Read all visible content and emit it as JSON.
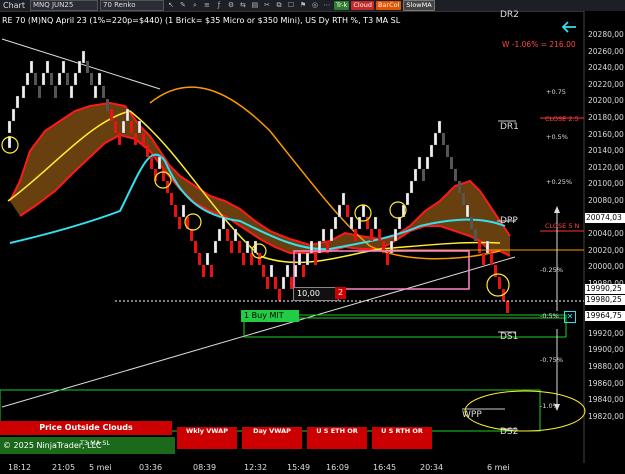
{
  "toolbar": {
    "chart_label": "Chart",
    "instrument": "MNQ JUN25",
    "bar_type": "70 Renko",
    "pills": [
      {
        "label": "Tr-k",
        "color": "#2e7d32"
      },
      {
        "label": "Cloud",
        "color": "#c62828"
      },
      {
        "label": "BarCol",
        "color": "#e65100"
      },
      {
        "label": "SlowMA",
        "color": "#444444"
      }
    ]
  },
  "info_line": "RE 70 (M)NQ April 23 (1%=220p=$440) (1 Brick= $35 Micro or $350 Mini), US Dy RTH %, T3 MA SL",
  "labels": {
    "dr2": "DR2",
    "dr1": "DR1",
    "dpp": "DPP",
    "ds1": "DS1",
    "ds2": "DS2",
    "wpp": "WPP",
    "w_pct": "W -1.06% = 216.00",
    "close_25": "CLOSE 2.5",
    "close_5": "CLOSE 5 N",
    "pct_075": "+0.75",
    "pct_05": "+0.5%",
    "pct_025": "+0.25%",
    "pct_m025": "-0.25%",
    "pct_m05": "-0.5%",
    "pct_m075": "-0.75%",
    "pct_m1": "-1.0%"
  },
  "order": {
    "qty_price": "10,00",
    "qty": "2",
    "buy_label": "1  Buy MIT"
  },
  "price_axis": {
    "ticks": [
      "20280,00",
      "20260,00",
      "20240,00",
      "20220,00",
      "20200,00",
      "20180,00",
      "20160,00",
      "20140,00",
      "20120,00",
      "20100,00",
      "20080,00",
      "20060,00",
      "20040,00",
      "20020,00",
      "20000,00",
      "19980,00",
      "19960,00",
      "19940,00",
      "19920,00",
      "19900,00",
      "19880,00",
      "19860,00",
      "19840,00",
      "19820,00"
    ],
    "markers": [
      {
        "text": "20074,03",
        "bg": "#ffffff",
        "fg": "#000000"
      },
      {
        "text": "19990,25",
        "bg": "#ffffff",
        "fg": "#000000"
      },
      {
        "text": "19980,25",
        "bg": "#ffffff",
        "fg": "#000000"
      },
      {
        "text": "19964,75",
        "bg": "#ffffff",
        "fg": "#000000"
      }
    ]
  },
  "time_axis": [
    "18:12",
    "21:05",
    "5 mei",
    "03:36",
    "08:39",
    "12:32",
    "15:49",
    "16:09",
    "16:45",
    "20:34",
    "6 mei"
  ],
  "bottom_panel": {
    "price_outside": "Price Outside Clouds",
    "t3_ma_sl": "T3 MA SL",
    "copyright": "© 2025 NinjaTrader, LLC",
    "buttons": [
      "Wkly VWAP",
      "Day VWAP",
      "U S ETH OR",
      "U S RTH OR"
    ]
  },
  "chart_data": {
    "type": "renko",
    "instrument": "MNQ JUN25",
    "brick_size": 70,
    "ylim": [
      19810,
      20290
    ],
    "last_price": 19990.25
  }
}
